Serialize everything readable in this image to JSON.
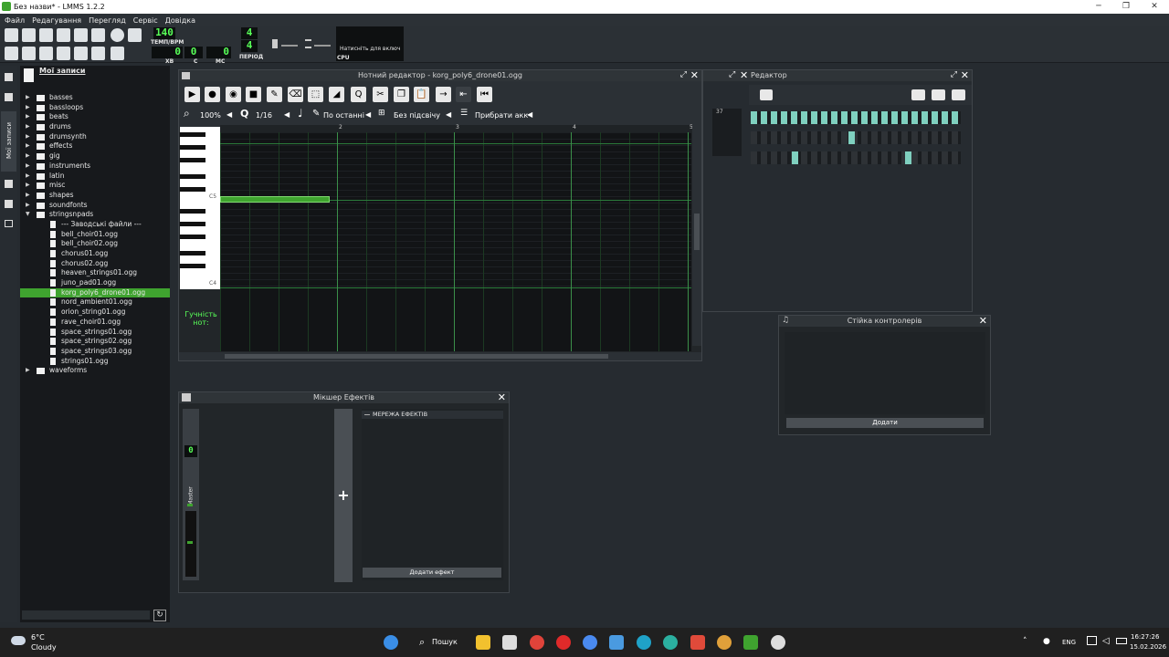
{
  "window": {
    "title": "Без назви* - LMMS 1.2.2"
  },
  "menu": [
    "Файл",
    "Редагування",
    "Перегляд",
    "Сервіс",
    "Довідка"
  ],
  "transport": {
    "tempo": "140",
    "tempo_label": "ТЕМП/BPM",
    "time_sig_num": "4",
    "time_sig_den": "4",
    "period_label": "ПЕРІОД",
    "min": "0",
    "sec": "0",
    "ms": "0",
    "min_label": "ХВ",
    "sec_label": "С",
    "ms_label": "МС",
    "cpu_label": "CPU",
    "cpu_hint": "Натисніть для включ"
  },
  "sidebar": {
    "title": "Мої записи",
    "tab_label": "Мої записи",
    "items": [
      {
        "label": "basses",
        "type": "folder"
      },
      {
        "label": "bassloops",
        "type": "folder"
      },
      {
        "label": "beats",
        "type": "folder"
      },
      {
        "label": "drums",
        "type": "folder"
      },
      {
        "label": "drumsynth",
        "type": "folder"
      },
      {
        "label": "effects",
        "type": "folder"
      },
      {
        "label": "gig",
        "type": "folder"
      },
      {
        "label": "instruments",
        "type": "folder"
      },
      {
        "label": "latin",
        "type": "folder"
      },
      {
        "label": "misc",
        "type": "folder"
      },
      {
        "label": "shapes",
        "type": "folder"
      },
      {
        "label": "soundfonts",
        "type": "folder"
      },
      {
        "label": "stringsnpads",
        "type": "folder-open"
      },
      {
        "label": "--- Заводські файли ---",
        "type": "file"
      },
      {
        "label": "bell_choir01.ogg",
        "type": "file"
      },
      {
        "label": "bell_choir02.ogg",
        "type": "file"
      },
      {
        "label": "chorus01.ogg",
        "type": "file"
      },
      {
        "label": "chorus02.ogg",
        "type": "file"
      },
      {
        "label": "heaven_strings01.ogg",
        "type": "file"
      },
      {
        "label": "juno_pad01.ogg",
        "type": "file"
      },
      {
        "label": "korg_poly6_drone01.ogg",
        "type": "file",
        "selected": true
      },
      {
        "label": "nord_ambient01.ogg",
        "type": "file"
      },
      {
        "label": "orion_string01.ogg",
        "type": "file"
      },
      {
        "label": "rave_choir01.ogg",
        "type": "file"
      },
      {
        "label": "space_strings01.ogg",
        "type": "file"
      },
      {
        "label": "space_strings02.ogg",
        "type": "file"
      },
      {
        "label": "space_strings03.ogg",
        "type": "file"
      },
      {
        "label": "strings01.ogg",
        "type": "file"
      },
      {
        "label": "waveforms",
        "type": "folder"
      }
    ]
  },
  "piano_roll": {
    "title": "Нотний редактор - korg_poly6_drone01.ogg",
    "zoom": "100%",
    "quantize": "1/16",
    "note_len": "По останні",
    "scale": "Без підсвічу",
    "chord": "Прибрати акк",
    "key_c5": "C5",
    "key_c4": "C4",
    "bars": [
      "2",
      "3",
      "4",
      "5"
    ],
    "velocity_label": "Гучність нот:"
  },
  "song_editor": {
    "title": "Редактор",
    "bar": "37"
  },
  "mixer": {
    "title": "Мікшер Ефектів",
    "channel": "Master",
    "chain_label": "МЕРЕЖА ЕФЕКТІВ",
    "add_effect": "Додати ефект",
    "fader_value": "0"
  },
  "controller": {
    "title": "Стійка контролерів",
    "add": "Додати"
  },
  "taskbar": {
    "weather_temp": "6°C",
    "weather_desc": "Cloudy",
    "search": "Пошук",
    "lang": "ENG",
    "time": "16:27:26",
    "date": "15.02.2026"
  }
}
